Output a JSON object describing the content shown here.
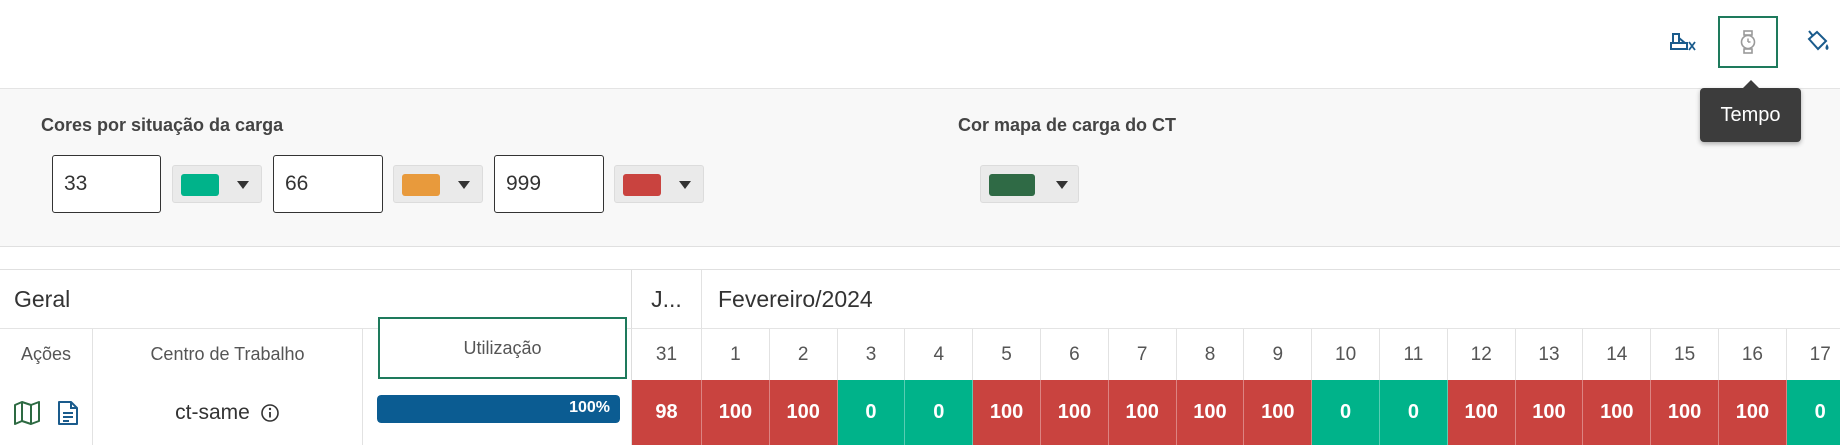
{
  "toolbar": {
    "buttons": [
      {
        "name": "machine-clear-icon",
        "active": false
      },
      {
        "name": "watch-icon",
        "active": true
      },
      {
        "name": "paint-bucket-icon",
        "active": false
      }
    ],
    "tooltip": "Tempo"
  },
  "config": {
    "load_colors_title": "Cores por situação da carga",
    "thresholds": [
      {
        "value": "33",
        "color": "#00b38a"
      },
      {
        "value": "66",
        "color": "#e89a3c"
      },
      {
        "value": "999",
        "color": "#c9433f"
      }
    ],
    "map_color_title": "Cor mapa de carga do CT",
    "map_color": "#2f6a45"
  },
  "grid": {
    "group_general": "Geral",
    "group_prev_month": "J...",
    "group_month": "Fevereiro/2024",
    "col_actions": "Ações",
    "col_work_center": "Centro de Trabalho",
    "col_utilization": "Utilização",
    "row": {
      "work_center": "ct-same",
      "utilization": "100%",
      "utilization_fraction": 1.0
    },
    "days": [
      {
        "day": "31",
        "value": "98",
        "status": "high"
      },
      {
        "day": "1",
        "value": "100",
        "status": "high"
      },
      {
        "day": "2",
        "value": "100",
        "status": "high"
      },
      {
        "day": "3",
        "value": "0",
        "status": "low"
      },
      {
        "day": "4",
        "value": "0",
        "status": "low"
      },
      {
        "day": "5",
        "value": "100",
        "status": "high"
      },
      {
        "day": "6",
        "value": "100",
        "status": "high"
      },
      {
        "day": "7",
        "value": "100",
        "status": "high"
      },
      {
        "day": "8",
        "value": "100",
        "status": "high"
      },
      {
        "day": "9",
        "value": "100",
        "status": "high"
      },
      {
        "day": "10",
        "value": "0",
        "status": "low"
      },
      {
        "day": "11",
        "value": "0",
        "status": "low"
      },
      {
        "day": "12",
        "value": "100",
        "status": "high"
      },
      {
        "day": "13",
        "value": "100",
        "status": "high"
      },
      {
        "day": "14",
        "value": "100",
        "status": "high"
      },
      {
        "day": "15",
        "value": "100",
        "status": "high"
      },
      {
        "day": "16",
        "value": "100",
        "status": "high"
      },
      {
        "day": "17",
        "value": "0",
        "status": "low"
      }
    ],
    "colors": {
      "high": "#c9433f",
      "low": "#00b38a",
      "bar": "#0b5c92"
    }
  }
}
